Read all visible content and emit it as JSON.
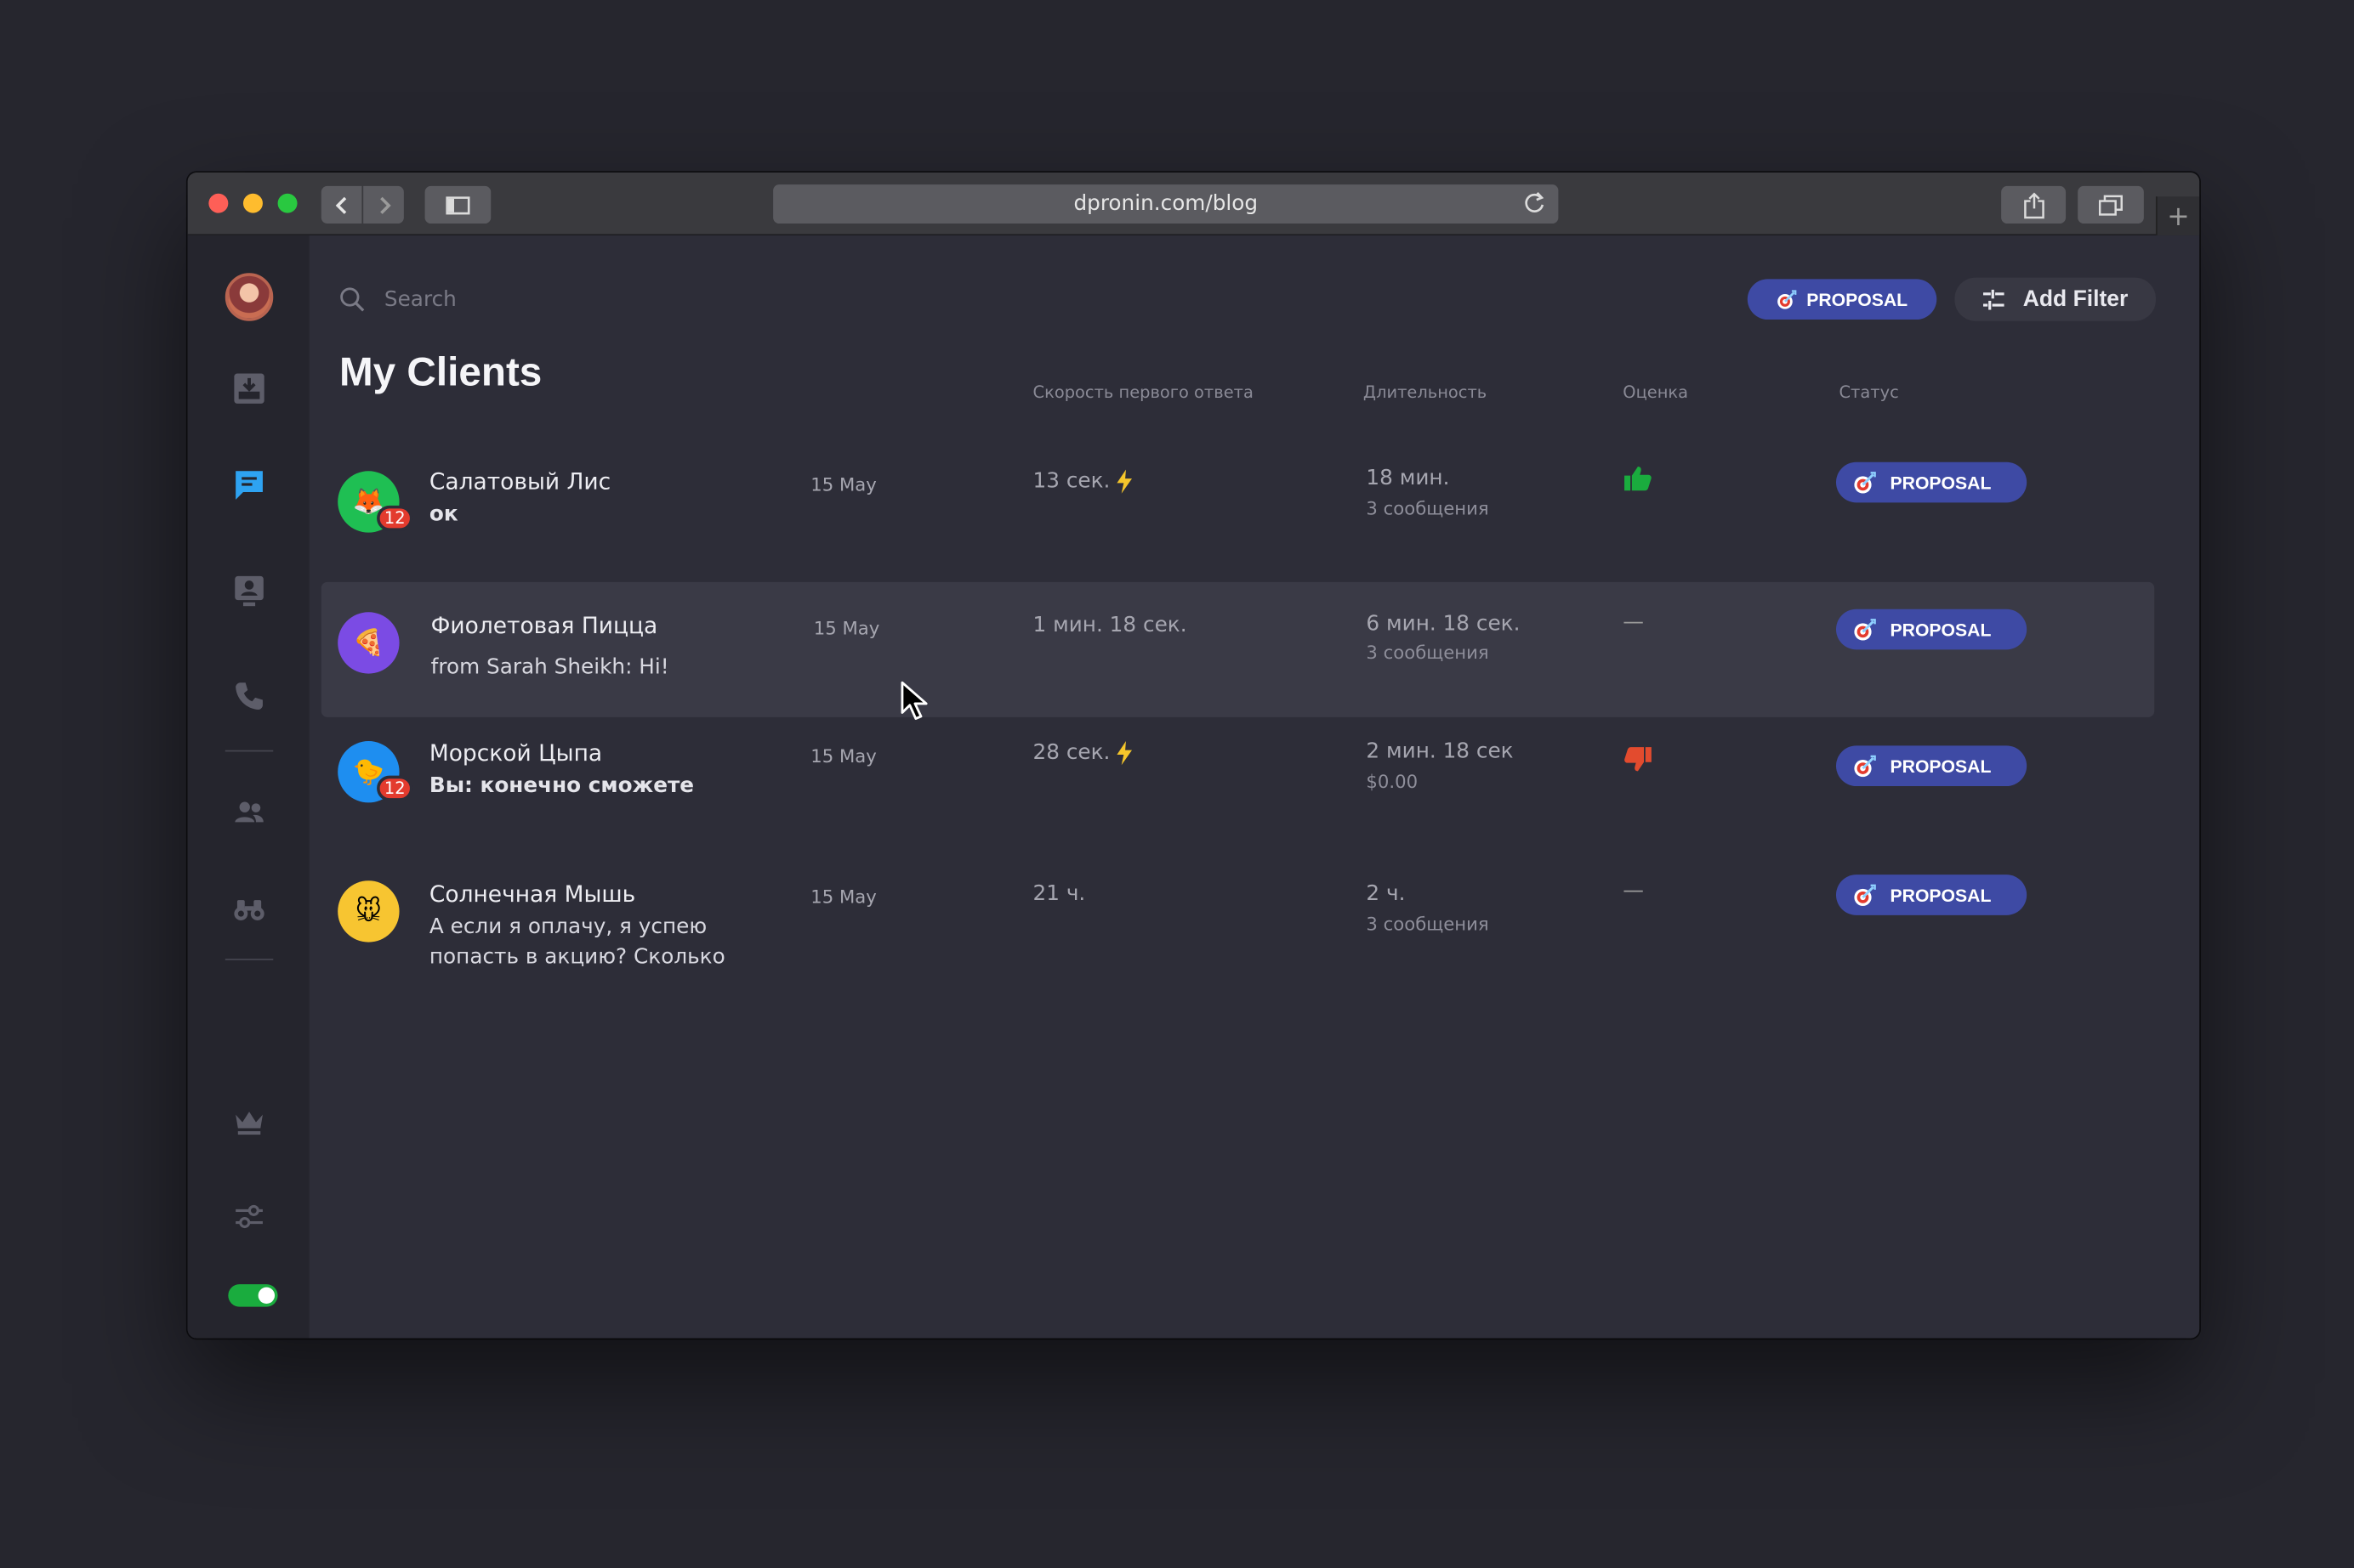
{
  "browser": {
    "url": "dpronin.com/blog",
    "new_tab": "+"
  },
  "colors": {
    "accent": "#3e4aa4",
    "active_nav": "#2ea3f2",
    "badge": "#e33b2e",
    "thumb_up": "#1aac3e",
    "thumb_down": "#e34b2e",
    "toggle_on": "#1aac3e"
  },
  "sidebar": {
    "items": [
      {
        "icon": "inbox-icon"
      },
      {
        "icon": "chat-icon",
        "active": true
      },
      {
        "icon": "contact-card-icon"
      },
      {
        "icon": "phone-icon"
      },
      {
        "icon": "users-icon"
      },
      {
        "icon": "binoculars-icon"
      },
      {
        "icon": "crown-icon"
      },
      {
        "icon": "sliders-icon"
      }
    ],
    "toggle_on": true
  },
  "search": {
    "placeholder": "Search"
  },
  "toolbar": {
    "proposal_label": "PROPOSAL",
    "add_filter_label": "Add Filter"
  },
  "page": {
    "title": "My Clients"
  },
  "columns": {
    "speed": "Скорость первого ответа",
    "duration": "Длительность",
    "rating": "Оценка",
    "status": "Статус"
  },
  "clients": [
    {
      "name": "Салатовый Лис",
      "message": "ок",
      "date": "15 May",
      "speed": "13 сек.",
      "fast": true,
      "duration": "18 мин.",
      "duration_sub": "3 сообщения",
      "rating": "thumb-up",
      "status": "PROPOSAL",
      "unread": "12",
      "avatar_color": "#1fbf53",
      "avatar_emoji": "🦊"
    },
    {
      "name": "Фиолетовая Пицца",
      "message": "from Sarah Sheikh: Hi!",
      "date": "15 May",
      "speed": "1 мин. 18 сек.",
      "fast": false,
      "duration": "6 мин. 18 сек.",
      "duration_sub": "3 сообщения",
      "rating": "—",
      "status": "PROPOSAL",
      "avatar_color": "#7b4be4",
      "avatar_emoji": "🍕"
    },
    {
      "name": "Морской Цыпа",
      "message": "Вы: конечно сможете",
      "date": "15 May",
      "speed": "28 сек.",
      "fast": true,
      "duration": "2 мин. 18 сек",
      "duration_sub": "$0.00",
      "rating": "thumb-down",
      "status": "PROPOSAL",
      "unread": "12",
      "avatar_color": "#1e8ef0",
      "avatar_emoji": "🐤"
    },
    {
      "name": "Солнечная Мышь",
      "message": "А если я оплачу, я успею попасть в акцию? Сколько",
      "date": "15 May",
      "speed": "21 ч.",
      "fast": false,
      "duration": "2 ч.",
      "duration_sub": "3 сообщения",
      "rating": "—",
      "status": "PROPOSAL",
      "avatar_color": "#f7c531",
      "avatar_emoji": "🐭"
    }
  ]
}
